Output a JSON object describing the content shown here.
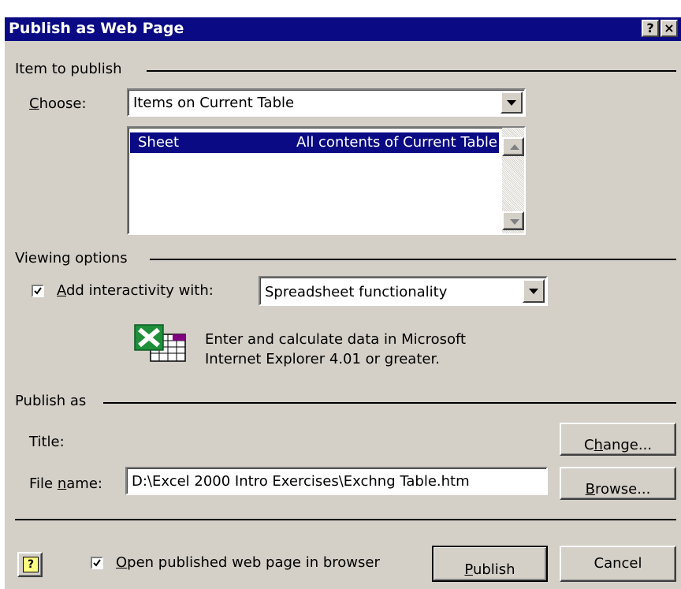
{
  "window": {
    "title": "Publish as Web Page",
    "help_btn": "?",
    "close_btn": "×"
  },
  "item_group": {
    "label": "Item to publish",
    "choose_label_u": "C",
    "choose_label_rest": "hoose:",
    "choose_value": "Items on Current Table",
    "list": [
      {
        "name": "Sheet",
        "desc": "All contents of Current Table",
        "selected": true
      }
    ]
  },
  "viewing_group": {
    "label": "Viewing options",
    "interactivity_checked": true,
    "interactivity_u": "A",
    "interactivity_rest": "dd interactivity with:",
    "interactivity_value": "Spreadsheet functionality",
    "info_line1": "Enter and calculate data in Microsoft",
    "info_line2": "Internet Explorer 4.01 or greater.",
    "icon": "excel-spreadsheet-icon"
  },
  "publish_group": {
    "label": "Publish as",
    "title_label": "Title:",
    "change_pre": "C",
    "change_u": "h",
    "change_post": "ange...",
    "filename_pre": "File ",
    "filename_u": "n",
    "filename_post": "ame:",
    "filename_value": "D:\\Excel 2000 Intro Exercises\\Exchng Table.htm",
    "browse_u": "B",
    "browse_rest": "rowse..."
  },
  "footer": {
    "open_checked": true,
    "open_u": "O",
    "open_rest": "pen published web page in browser",
    "publish_u": "P",
    "publish_rest": "ublish",
    "cancel": "Cancel",
    "help_icon": "?"
  },
  "colors": {
    "titlebar": "#0a0a84",
    "face": "#d4d0c8",
    "selection": "#0a0a84"
  }
}
